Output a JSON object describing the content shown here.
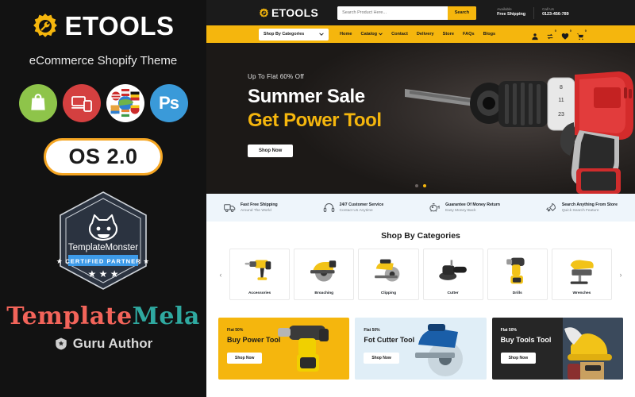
{
  "promo": {
    "logo_icon": "gear-wrench-icon",
    "brand": "ETOOLS",
    "subtitle": "eCommerce Shopify Theme",
    "features": [
      {
        "name": "shopify",
        "icon": "shopify-bag-icon",
        "color": "#8ec44a"
      },
      {
        "name": "responsive",
        "icon": "responsive-devices-icon",
        "color": "#d44040"
      },
      {
        "name": "multilanguage",
        "icon": "world-flags-icon",
        "color": "#ffffff"
      },
      {
        "name": "photoshop",
        "icon": "photoshop-icon",
        "label": "Ps",
        "color": "#3a9ad9"
      }
    ],
    "os_badge": "OS 2.0",
    "badge": {
      "icon": "templatemonster-monster-icon",
      "brand": "TemplateMonster",
      "ribbon": "CERTIFIED PARTNER",
      "stars": 3
    },
    "author_brand_part1": "Template",
    "author_brand_part2": "Mela",
    "author_role": "Guru Author",
    "author_icon": "guru-shield-icon",
    "colors": {
      "background": "#121212",
      "accent_yellow": "#f5a623",
      "brand_red": "#f2645a",
      "brand_teal": "#2fa9a0"
    }
  },
  "store": {
    "header": {
      "logo_icon": "gear-wrench-icon",
      "logo_text": "ETOOLS",
      "search": {
        "placeholder": "Search Product Here...",
        "value": "",
        "button_label": "Search"
      },
      "info_blocks": [
        {
          "label": "Available",
          "value": "Free Shipping"
        },
        {
          "label": "Call Us",
          "value": "0123-456-789"
        }
      ]
    },
    "nav": {
      "categories_button": "Shop By Categories",
      "categories_icon": "chevron-down-icon",
      "links": [
        {
          "label": "Home",
          "has_caret": false
        },
        {
          "label": "Catalog",
          "has_caret": true
        },
        {
          "label": "Contact",
          "has_caret": false
        },
        {
          "label": "Delivery",
          "has_caret": false
        },
        {
          "label": "Store",
          "has_caret": false
        },
        {
          "label": "FAQs",
          "has_caret": false
        },
        {
          "label": "Blogs",
          "has_caret": false
        }
      ],
      "icons": [
        {
          "name": "account-icon",
          "badge": ""
        },
        {
          "name": "compare-icon",
          "badge": "0"
        },
        {
          "name": "wishlist-heart-icon",
          "badge": "0"
        },
        {
          "name": "cart-icon",
          "badge": "0"
        }
      ]
    },
    "hero": {
      "kicker": "Up To Flat 60% Off",
      "headline": "Summer Sale",
      "subheadline": "Get Power Tool",
      "cta": "Shop Now",
      "image": "red-power-drill-photo",
      "slides": 2,
      "active_slide": 2
    },
    "services": [
      {
        "icon": "delivery-truck-icon",
        "title": "Fast Free Shipping",
        "subtitle": "Around The World"
      },
      {
        "icon": "headset-icon",
        "title": "24/7 Customer Service",
        "subtitle": "Contact Us Anytime"
      },
      {
        "icon": "piggy-bank-icon",
        "title": "Guarantee Of Money Return",
        "subtitle": "Easy Money Back"
      },
      {
        "icon": "rocket-icon",
        "title": "Search Anything From Store",
        "subtitle": "Quick Search Feature"
      }
    ],
    "categories": {
      "title": "Shop By Categories",
      "prev_icon": "chevron-left-icon",
      "next_icon": "chevron-right-icon",
      "items": [
        {
          "name": "Accessories",
          "image": "yellow-rotary-hammer"
        },
        {
          "name": "Broaching",
          "image": "yellow-circular-saw"
        },
        {
          "name": "Clipping",
          "image": "yellow-tile-cutter"
        },
        {
          "name": "Cutter",
          "image": "black-angle-polisher"
        },
        {
          "name": "Drills",
          "image": "yellow-cordless-drill"
        },
        {
          "name": "Wrenches",
          "image": "yellow-jigsaw"
        }
      ]
    },
    "banners": [
      {
        "flat": "Flat 50%",
        "title": "Buy Power Tool",
        "cta": "Shop Now",
        "bg": "#f5b60d",
        "image": "yellow-cordless-drill-photo"
      },
      {
        "flat": "Flat 50%",
        "title": "Fot Cutter Tool",
        "cta": "Shop Now",
        "bg": "#e0eef7",
        "image": "blue-tile-cutter-photo"
      },
      {
        "flat": "Flat 50%",
        "title": "Buy Tools Tool",
        "cta": "Shop Now",
        "bg": "#262626",
        "image": "worker-helmet-photo"
      }
    ],
    "colors": {
      "yellow": "#f5b60d",
      "dark": "#1b1b1b",
      "services_bg": "#eef5fb"
    }
  }
}
